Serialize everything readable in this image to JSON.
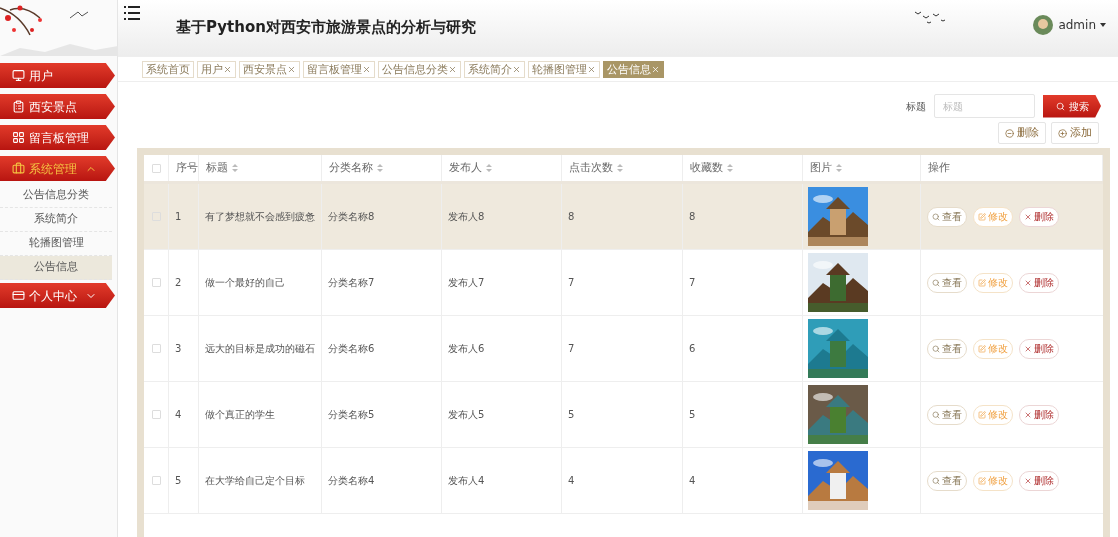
{
  "header": {
    "title": "基于Python对西安市旅游景点的分析与研究",
    "user": "admin"
  },
  "sidebar": {
    "items": [
      {
        "label": "用户",
        "expanded": false
      },
      {
        "label": "西安景点",
        "expanded": false
      },
      {
        "label": "留言板管理",
        "expanded": false
      },
      {
        "label": "系统管理",
        "expanded": true,
        "children": [
          {
            "label": "公告信息分类",
            "selected": false
          },
          {
            "label": "系统简介",
            "selected": false
          },
          {
            "label": "轮播图管理",
            "selected": false
          },
          {
            "label": "公告信息",
            "selected": true
          }
        ]
      },
      {
        "label": "个人中心",
        "expanded": false
      }
    ]
  },
  "tabs": [
    {
      "label": "系统首页",
      "closable": false,
      "selected": false
    },
    {
      "label": "用户",
      "closable": true,
      "selected": false
    },
    {
      "label": "西安景点",
      "closable": true,
      "selected": false
    },
    {
      "label": "留言板管理",
      "closable": true,
      "selected": false
    },
    {
      "label": "公告信息分类",
      "closable": true,
      "selected": false
    },
    {
      "label": "系统简介",
      "closable": true,
      "selected": false
    },
    {
      "label": "轮播图管理",
      "closable": true,
      "selected": false
    },
    {
      "label": "公告信息",
      "closable": true,
      "selected": true
    }
  ],
  "search": {
    "label": "标题",
    "placeholder": "标题",
    "button": "搜索"
  },
  "actions": [
    {
      "label": "删除",
      "kind": "remove"
    },
    {
      "label": "添加",
      "kind": "add"
    }
  ],
  "table": {
    "all_checked": false,
    "columns": [
      {
        "label": "序号",
        "sortable": false
      },
      {
        "label": "标题",
        "sortable": true
      },
      {
        "label": "分类名称",
        "sortable": true
      },
      {
        "label": "发布人",
        "sortable": true
      },
      {
        "label": "点击次数",
        "sortable": true
      },
      {
        "label": "收藏数",
        "sortable": true
      },
      {
        "label": "图片",
        "sortable": true
      },
      {
        "label": "操作",
        "sortable": false
      }
    ],
    "rows": [
      {
        "index": "1",
        "title": "有了梦想就不会感到疲惫",
        "category": "分类名称8",
        "publisher": "发布人8",
        "clicks": "8",
        "favorites": "8",
        "highlighted": true,
        "checked": false,
        "actions": [
          {
            "label": "查看",
            "kind": "view"
          },
          {
            "label": "修改",
            "kind": "edit"
          },
          {
            "label": "删除",
            "kind": "delete"
          }
        ]
      },
      {
        "index": "2",
        "title": "做一个最好的自己",
        "category": "分类名称7",
        "publisher": "发布人7",
        "clicks": "7",
        "favorites": "7",
        "highlighted": false,
        "checked": false,
        "actions": [
          {
            "label": "查看",
            "kind": "view"
          },
          {
            "label": "修改",
            "kind": "edit"
          },
          {
            "label": "删除",
            "kind": "delete"
          }
        ]
      },
      {
        "index": "3",
        "title": "远大的目标是成功的磁石",
        "category": "分类名称6",
        "publisher": "发布人6",
        "clicks": "7",
        "favorites": "6",
        "highlighted": false,
        "checked": false,
        "actions": [
          {
            "label": "查看",
            "kind": "view"
          },
          {
            "label": "修改",
            "kind": "edit"
          },
          {
            "label": "删除",
            "kind": "delete"
          }
        ]
      },
      {
        "index": "4",
        "title": "做个真正的学生",
        "category": "分类名称5",
        "publisher": "发布人5",
        "clicks": "5",
        "favorites": "5",
        "highlighted": false,
        "checked": false,
        "actions": [
          {
            "label": "查看",
            "kind": "view"
          },
          {
            "label": "修改",
            "kind": "edit"
          },
          {
            "label": "删除",
            "kind": "delete"
          }
        ]
      },
      {
        "index": "5",
        "title": "在大学给自己定个目标",
        "category": "分类名称4",
        "publisher": "发布人4",
        "clicks": "4",
        "favorites": "4",
        "highlighted": false,
        "checked": false,
        "actions": [
          {
            "label": "查看",
            "kind": "view"
          },
          {
            "label": "修改",
            "kind": "edit"
          },
          {
            "label": "删除",
            "kind": "delete"
          }
        ]
      }
    ]
  }
}
